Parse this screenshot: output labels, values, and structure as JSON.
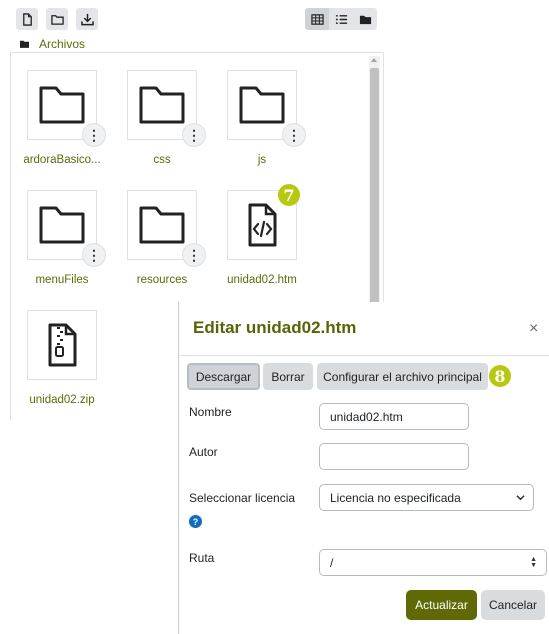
{
  "toolbar": {
    "buttons": [
      {
        "name": "create-file-button",
        "icon": "file-icon"
      },
      {
        "name": "create-folder-button",
        "icon": "folder-icon"
      },
      {
        "name": "download-button",
        "icon": "download-icon"
      }
    ],
    "views": [
      {
        "name": "view-icons-button",
        "icon": "grid-icon",
        "active": true
      },
      {
        "name": "view-details-button",
        "icon": "list-icon",
        "active": false
      },
      {
        "name": "view-tree-button",
        "icon": "folder-solid-icon",
        "active": false
      }
    ]
  },
  "breadcrumb": {
    "label": "Archivos"
  },
  "files": [
    {
      "name": "ardoraBasico...",
      "type": "folder"
    },
    {
      "name": "css",
      "type": "folder"
    },
    {
      "name": "js",
      "type": "folder"
    },
    {
      "name": "menuFiles",
      "type": "folder"
    },
    {
      "name": "resources",
      "type": "folder"
    },
    {
      "name": "unidad02.htm",
      "type": "code-file"
    },
    {
      "name": "unidad02.zip",
      "type": "zip-file"
    }
  ],
  "callouts": {
    "file_badge": "7",
    "button_badge": "8"
  },
  "dialog": {
    "title": "Editar unidad02.htm",
    "close_label": "×",
    "actions": {
      "download": "Descargar",
      "delete": "Borrar",
      "set_main": "Configurar el archivo principal"
    },
    "fields": {
      "name_label": "Nombre",
      "name_value": "unidad02.htm",
      "author_label": "Autor",
      "author_value": "",
      "license_label": "Seleccionar licencia",
      "license_value": "Licencia no especificada",
      "license_help": "?",
      "path_label": "Ruta",
      "path_value": "/"
    },
    "footer": {
      "update": "Actualizar",
      "cancel": "Cancelar"
    }
  },
  "colors": {
    "accent": "#5f6a07",
    "badge": "#b8c80f",
    "help": "#0f6cbf"
  }
}
